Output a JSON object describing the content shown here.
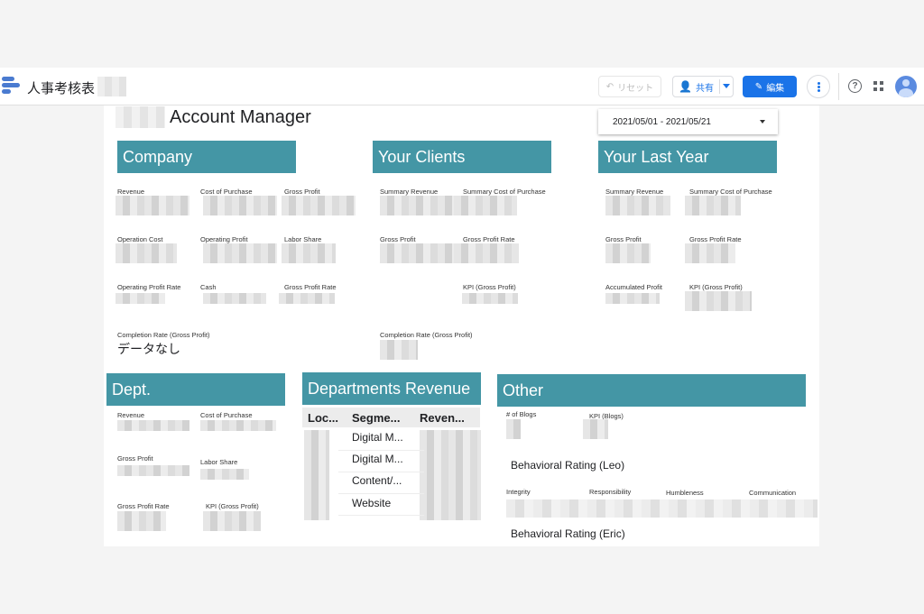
{
  "app": {
    "doc_title": "人事考核表",
    "reset_label": "リセット",
    "share_label": "共有",
    "edit_label": "編集",
    "help_glyph": "?"
  },
  "report": {
    "page_title": "Account Manager",
    "date_range": "2021/05/01 - 2021/05/21"
  },
  "company": {
    "header": "Company",
    "metrics": [
      "Revenue",
      "Cost of Purchase",
      "Gross Profit",
      "Operation Cost",
      "Operating Profit",
      "Labor Share",
      "Operating Profit Rate",
      "Cash",
      "Gross Profit Rate"
    ],
    "completion_label": "Completion Rate (Gross Profit)",
    "no_data": "データなし"
  },
  "your_clients": {
    "header": "Your Clients",
    "metrics": [
      "Summary Revenue",
      "Summary Cost of Purchase",
      "Gross Profit",
      "Gross Profit Rate",
      "KPI (Gross Profit)",
      "Completion Rate (Gross Profit)"
    ]
  },
  "last_year": {
    "header": "Your Last Year",
    "metrics": [
      "Summary Revenue",
      "Summary Cost of Purchase",
      "Gross Profit",
      "Gross Profit Rate",
      "Accumulated Profit",
      "KPI (Gross Profit)"
    ]
  },
  "dept": {
    "header": "Dept.",
    "metrics": [
      "Revenue",
      "Cost of Purchase",
      "Gross Profit",
      "Labor Share",
      "Gross Profit Rate",
      "KPI (Gross Profit)"
    ]
  },
  "departments_revenue": {
    "header": "Departments Revenue",
    "columns": [
      "Loc...",
      "Segme...",
      "Reven..."
    ],
    "segments": [
      "Digital M...",
      "Digital M...",
      "Content/...",
      "Website"
    ]
  },
  "other": {
    "header": "Other",
    "metrics": [
      "# of Blogs",
      "KPI (Blogs)"
    ],
    "rating_leo": "Behavioral Rating (Leo)",
    "rating_columns": [
      "Integrity",
      "Responsibility",
      "Humbleness",
      "Communication"
    ],
    "rating_eric": "Behavioral Rating (Eric)"
  },
  "colors": {
    "section_header": "#4496a5",
    "primary_button": "#1a73e8"
  }
}
